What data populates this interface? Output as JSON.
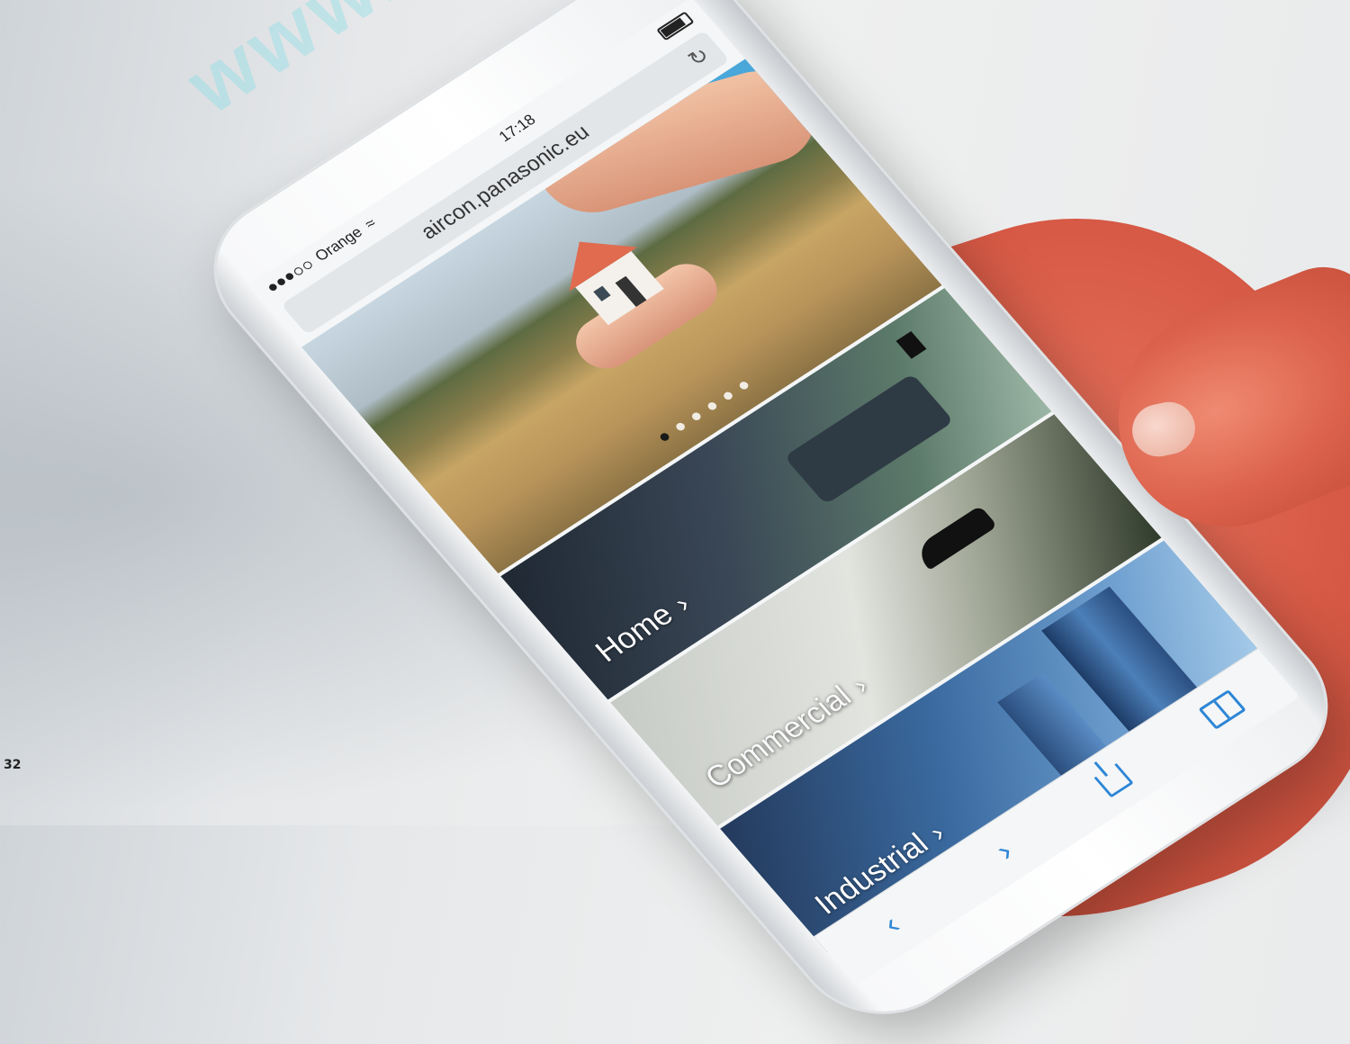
{
  "page": {
    "number": "32",
    "watermark": "www.p"
  },
  "status_bar": {
    "carrier": "Orange",
    "time": "17:18"
  },
  "browser": {
    "url": "aircon.panasonic.eu"
  },
  "carousel": {
    "slide_count": 6,
    "active_index": 0
  },
  "categories": [
    {
      "label": "Home",
      "chevron": "›"
    },
    {
      "label": "Commercial",
      "chevron": "›"
    },
    {
      "label": "Industrial",
      "chevron": "›"
    }
  ],
  "toolbar": {
    "back": "‹",
    "forward": "›"
  },
  "icons": [
    "wifi-icon",
    "battery-icon",
    "reload-icon",
    "chevron-right-icon",
    "back-icon",
    "forward-icon",
    "share-icon",
    "bookmarks-icon"
  ],
  "colors": {
    "accent": "#2d86d6",
    "skin": "#d75a46"
  }
}
